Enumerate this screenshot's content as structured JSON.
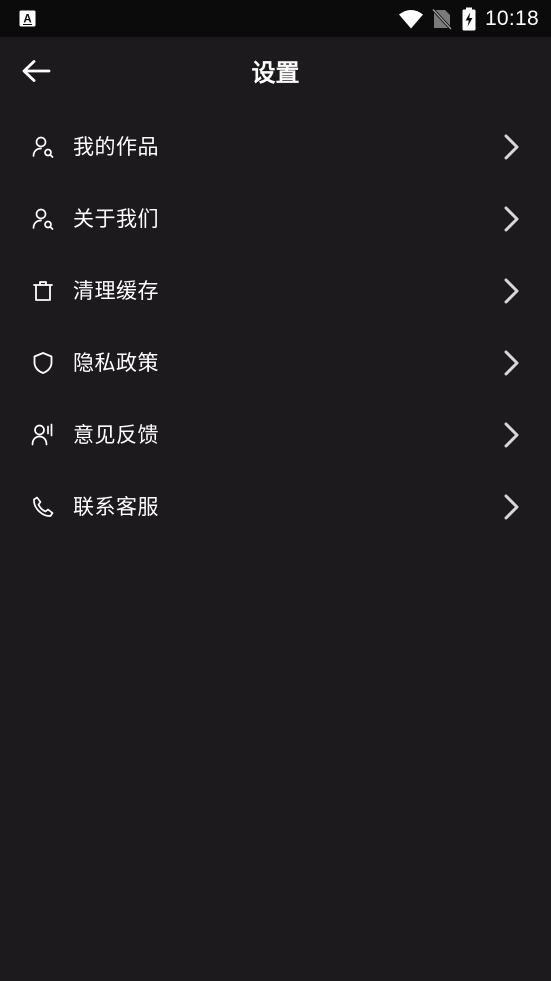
{
  "status_bar": {
    "time": "10:18",
    "app_icon_label": "A",
    "icons": [
      "app-notification-icon",
      "wifi-icon",
      "no-sim-icon",
      "battery-charging-icon"
    ]
  },
  "header": {
    "title": "设置",
    "back_icon": "arrow-left-icon"
  },
  "menu": {
    "items": [
      {
        "label": "我的作品",
        "icon": "user-search-icon"
      },
      {
        "label": "关于我们",
        "icon": "user-search-icon"
      },
      {
        "label": "清理缓存",
        "icon": "trash-icon"
      },
      {
        "label": "隐私政策",
        "icon": "shield-icon"
      },
      {
        "label": "意见反馈",
        "icon": "user-voice-icon"
      },
      {
        "label": "联系客服",
        "icon": "phone-icon"
      }
    ],
    "chevron_icon": "chevron-right-icon"
  },
  "colors": {
    "background": "#1c1a1c",
    "status_bar": "#0b0b0b",
    "text": "#ffffff",
    "chevron": "#d8d8d8"
  }
}
